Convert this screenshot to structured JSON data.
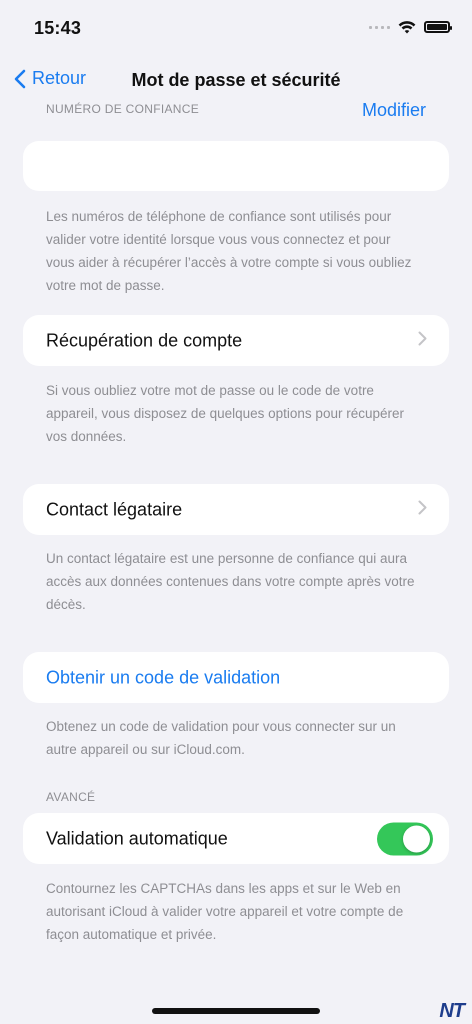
{
  "status_bar": {
    "time": "15:43"
  },
  "nav": {
    "back_label": "Retour",
    "title": "Mot de passe et sécurité"
  },
  "trusted_numbers": {
    "header": "NUMÉRO DE CONFIANCE",
    "edit_label": "Modifier",
    "footnote": "Les numéros de téléphone de confiance sont utilisés pour valider votre identité lorsque vous vous connectez et pour vous aider à récupérer l’accès à votre compte si vous oubliez votre mot de passe."
  },
  "account_recovery": {
    "label": "Récupération de compte",
    "footnote": "Si vous oubliez votre mot de passe ou le code de votre appareil, vous disposez de quelques options pour récupérer vos données."
  },
  "legacy_contact": {
    "label": "Contact légataire",
    "footnote": "Un contact légataire est une personne de confiance qui aura accès aux données contenues dans votre compte après votre décès."
  },
  "verification_code": {
    "label": "Obtenir un code de validation",
    "footnote": "Obtenez un code de validation pour vous connecter sur un autre appareil ou sur iCloud.com."
  },
  "advanced": {
    "header": "AVANCÉ",
    "auto_validation_label": "Validation automatique",
    "auto_validation_on": true,
    "footnote": "Contournez les CAPTCHAs dans les apps et sur le Web en autorisant iCloud à valider votre appareil et votre compte de façon automatique et privée."
  },
  "watermark": "NT",
  "colors": {
    "accent": "#1a7cf0",
    "toggle_on": "#34c759",
    "background": "#f2f2f7"
  },
  "icons": [
    "chevron-left-icon",
    "chevron-right-icon",
    "wifi-icon",
    "battery-icon",
    "signal-icon"
  ]
}
